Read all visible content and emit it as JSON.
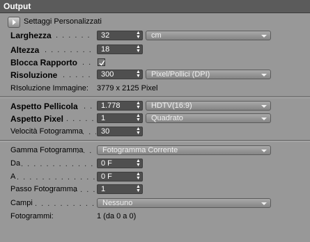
{
  "header": {
    "title": "Output"
  },
  "preset": {
    "label": "Settaggi Personalizzati"
  },
  "rows": {
    "width": {
      "label": "Larghezza",
      "dots": ". . . . . . . . .",
      "value": "32",
      "unit": "cm"
    },
    "height": {
      "label": "Altezza",
      "dots": ". . . . . . . . . . .",
      "value": "18"
    },
    "lock": {
      "label": "Blocca Rapporto",
      "dots": ". .",
      "checked": true
    },
    "resolution": {
      "label": "Risoluzione",
      "dots": ". . . . . . .",
      "value": "300",
      "unit": "Pixel/Pollici (DPI)"
    },
    "image_res": {
      "label": "RIsoluzione Immagine:",
      "value": "3779 x 2125 Pixel"
    },
    "film_aspect": {
      "label": "Aspetto Pellicola",
      "dots": ". .",
      "value": "1.778",
      "preset": "HDTV(16:9)"
    },
    "pixel_aspect": {
      "label": "Aspetto Pixel",
      "dots": ". . . . . .",
      "value": "1",
      "preset": "Quadrato"
    },
    "fps": {
      "label": "Velocità Fotogramma",
      "dots": ". . .",
      "value": "30"
    },
    "frame_range": {
      "label": "Gamma Fotogramma",
      "dots": ". . . . .",
      "value": "Fotogramma Corrente"
    },
    "from": {
      "label": "Da",
      "dots": ". . . . . . . . . . . . . . . . . .",
      "value": "0 F"
    },
    "to": {
      "label": "A",
      "dots": ". . . . . . . . . . . . . . . . . . .",
      "value": "0 F"
    },
    "step": {
      "label": "Passo Fotogramma",
      "dots": ". . . . .",
      "value": "1"
    },
    "fields": {
      "label": "Campi",
      "dots": ". . . . . . . . . . . . . . . .",
      "value": "Nessuno"
    },
    "frames": {
      "label": "Fotogrammi:",
      "value": "1 (da 0 a 0)"
    }
  }
}
